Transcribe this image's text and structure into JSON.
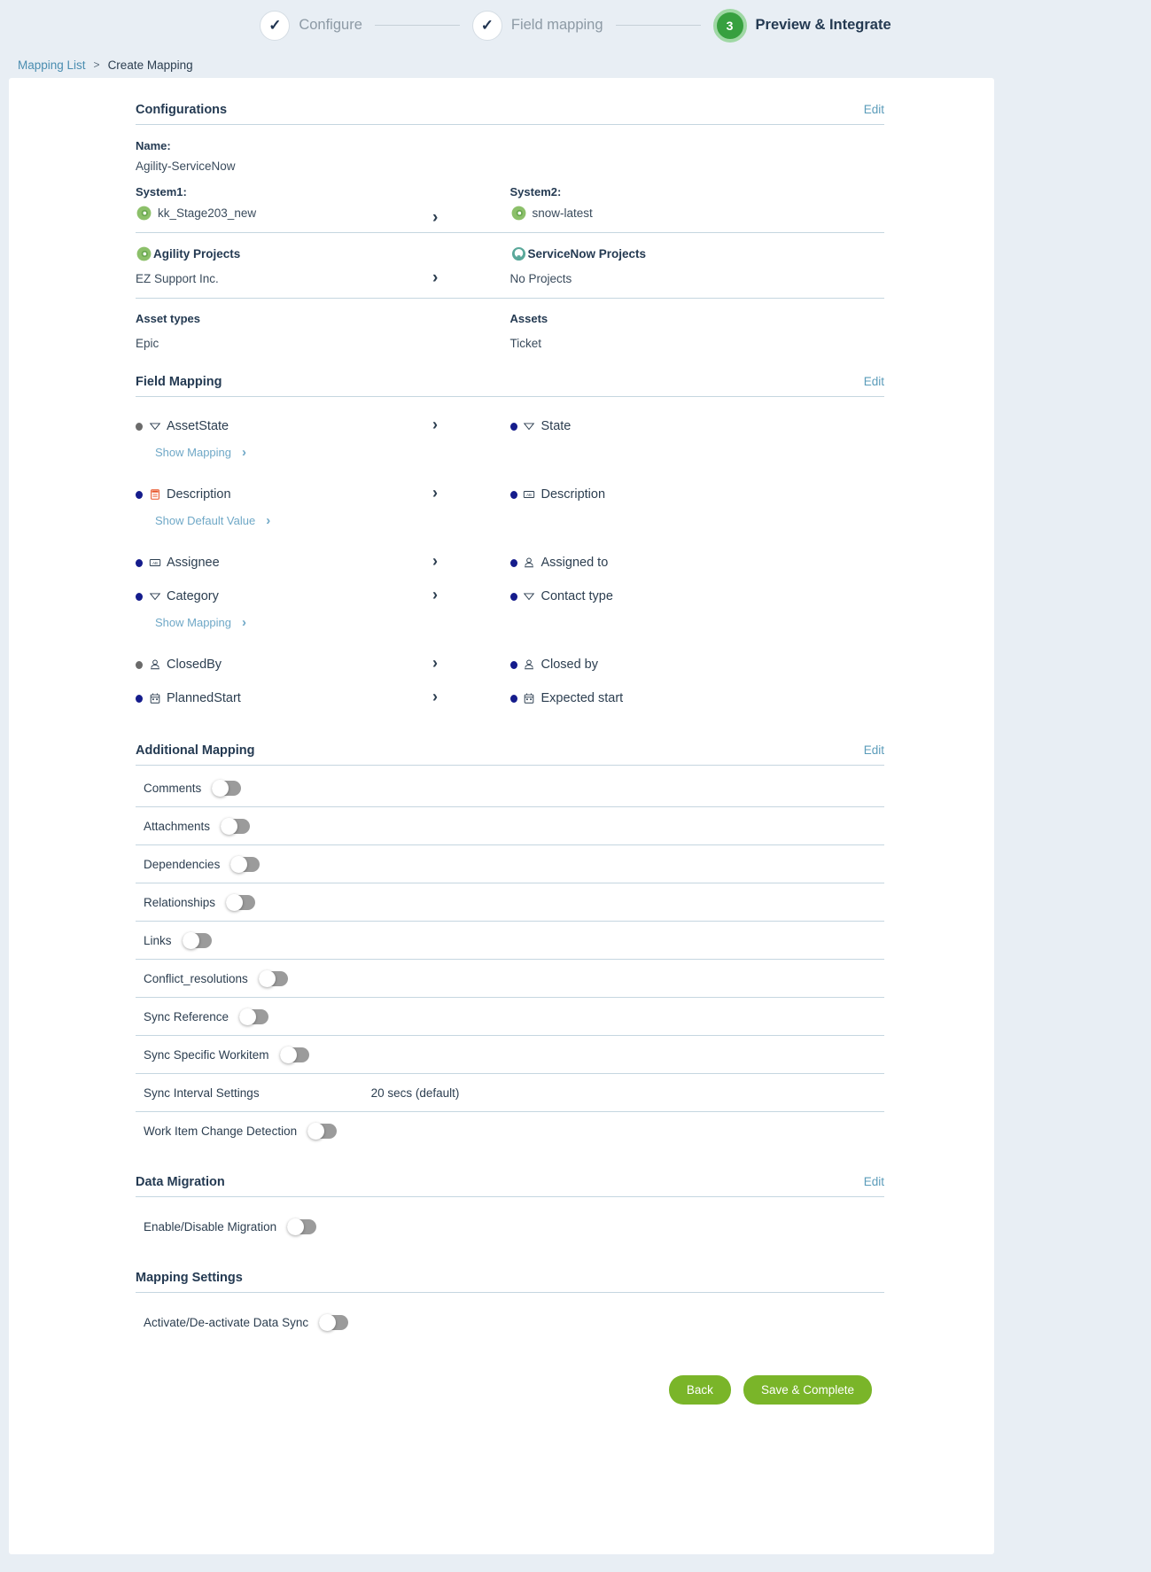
{
  "stepper": {
    "steps": [
      {
        "label": "Configure",
        "state": "done",
        "mark": "✓"
      },
      {
        "label": "Field mapping",
        "state": "done",
        "mark": "✓"
      },
      {
        "label": "Preview & Integrate",
        "state": "active",
        "mark": "3"
      }
    ]
  },
  "breadcrumb": {
    "root": "Mapping List",
    "separator": ">",
    "current": "Create Mapping"
  },
  "configurations": {
    "title": "Configurations",
    "edit_label": "Edit",
    "name_label": "Name:",
    "name_value": "Agility-ServiceNow",
    "system1_label": "System1:",
    "system1_value": "kk_Stage203_new",
    "system2_label": "System2:",
    "system2_value": "snow-latest",
    "projects_left_title": "Agility Projects",
    "projects_right_title": "ServiceNow Projects",
    "projects_left_value": "EZ Support Inc.",
    "projects_right_value": "No Projects",
    "asset_types_left_label": "Asset types",
    "asset_types_right_label": "Assets",
    "asset_types_left_value": "Epic",
    "asset_types_right_value": "Ticket"
  },
  "field_mapping": {
    "title": "Field Mapping",
    "edit_label": "Edit",
    "rows": [
      {
        "left": {
          "name": "AssetState",
          "dot": "grey",
          "icon": "dropdown-icon"
        },
        "right": {
          "name": "State",
          "dot": "blue",
          "icon": "dropdown-icon"
        },
        "sub_link": "Show Mapping"
      },
      {
        "left": {
          "name": "Description",
          "dot": "blue",
          "icon": "html-icon"
        },
        "right": {
          "name": "Description",
          "dot": "blue",
          "icon": "text-icon"
        },
        "sub_link": "Show Default Value"
      },
      {
        "left": {
          "name": "Assignee",
          "dot": "blue",
          "icon": "text-icon"
        },
        "right": {
          "name": "Assigned to",
          "dot": "blue",
          "icon": "user-icon"
        },
        "sub_link": ""
      },
      {
        "left": {
          "name": "Category",
          "dot": "blue",
          "icon": "dropdown-icon"
        },
        "right": {
          "name": "Contact type",
          "dot": "blue",
          "icon": "dropdown-icon"
        },
        "sub_link": "Show Mapping"
      },
      {
        "left": {
          "name": "ClosedBy",
          "dot": "grey",
          "icon": "user-icon"
        },
        "right": {
          "name": "Closed by",
          "dot": "blue",
          "icon": "user-icon"
        },
        "sub_link": ""
      },
      {
        "left": {
          "name": "PlannedStart",
          "dot": "blue",
          "icon": "calendar-icon"
        },
        "right": {
          "name": "Expected start",
          "dot": "blue",
          "icon": "calendar-icon"
        },
        "sub_link": ""
      }
    ]
  },
  "additional_mapping": {
    "title": "Additional Mapping",
    "edit_label": "Edit",
    "rows": [
      {
        "label": "Comments",
        "type": "toggle",
        "value": "off"
      },
      {
        "label": "Attachments",
        "type": "toggle",
        "value": "off"
      },
      {
        "label": "Dependencies",
        "type": "toggle",
        "value": "off"
      },
      {
        "label": "Relationships",
        "type": "toggle",
        "value": "off"
      },
      {
        "label": "Links",
        "type": "toggle",
        "value": "off"
      },
      {
        "label": "Conflict_resolutions",
        "type": "toggle",
        "value": "off"
      },
      {
        "label": "Sync Reference",
        "type": "toggle",
        "value": "off"
      },
      {
        "label": "Sync Specific Workitem",
        "type": "toggle",
        "value": "off"
      },
      {
        "label": "Sync Interval Settings",
        "type": "text",
        "value": "20 secs (default)"
      },
      {
        "label": "Work Item Change Detection",
        "type": "toggle",
        "value": "off"
      }
    ]
  },
  "data_migration": {
    "title": "Data Migration",
    "edit_label": "Edit",
    "rows": [
      {
        "label": "Enable/Disable Migration",
        "type": "toggle",
        "value": "off"
      }
    ]
  },
  "mapping_settings": {
    "title": "Mapping Settings",
    "rows": [
      {
        "label": "Activate/De-activate Data Sync",
        "type": "toggle",
        "value": "off"
      }
    ]
  },
  "footer": {
    "back_label": "Back",
    "save_label": "Save & Complete"
  },
  "colors": {
    "accent_green": "#7ab529",
    "step_active_green": "#37a03f",
    "link_blue": "#5b9cba",
    "page_bg": "#e8eef4",
    "dot_blue": "#151c8c",
    "dot_grey": "#6b6b6b"
  }
}
